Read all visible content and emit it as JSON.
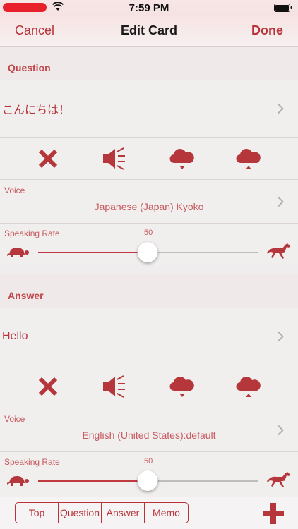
{
  "status_bar": {
    "time": "7:59 PM"
  },
  "nav": {
    "cancel": "Cancel",
    "title": "Edit Card",
    "done": "Done"
  },
  "question": {
    "header": "Question",
    "text": "こんにちは！",
    "voice_label": "Voice",
    "voice_value": "Japanese (Japan) Kyoko",
    "rate_label": "Speaking Rate",
    "rate_value": "50"
  },
  "answer": {
    "header": "Answer",
    "text": "Hello",
    "voice_label": "Voice",
    "voice_value": "English (United States):default",
    "rate_label": "Speaking Rate",
    "rate_value": "50"
  },
  "toolbar": {
    "top": "Top",
    "question": "Question",
    "answer": "Answer",
    "memo": "Memo"
  },
  "icons": [
    "x-icon",
    "speaker-icon",
    "cloud-download-icon",
    "cloud-upload-icon",
    "turtle-icon",
    "horse-icon",
    "chevron-right-icon",
    "plus-icon"
  ],
  "colors": {
    "accent": "#b8343a"
  }
}
